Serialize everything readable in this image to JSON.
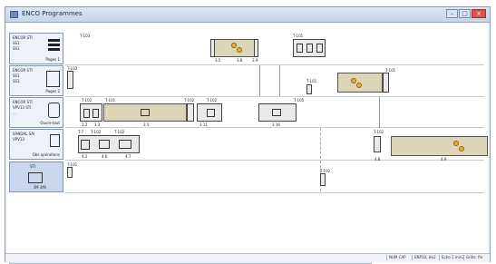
{
  "window": {
    "title": "ENCO Programmes"
  },
  "window_controls": {
    "minimize": "–",
    "maximize": "□",
    "close": "×"
  },
  "rows": [
    {
      "lines": [
        "ENCOR    STI",
        "SS1",
        "SS1"
      ],
      "caption": "Pages 1"
    },
    {
      "lines": [
        "ENCOR    STI",
        "SS1",
        "SS1"
      ],
      "caption": "Pages 2"
    },
    {
      "lines": [
        "ENCOR    STI",
        "VPV13   STI",
        "…"
      ],
      "caption": "Ouvre-tout"
    },
    {
      "lines": [
        "SANDAL    SAI",
        "VPV13"
      ],
      "caption": "Obs opérations"
    },
    {
      "lines": [
        "STI"
      ],
      "caption": "3M 4Mi"
    }
  ],
  "timeline_labels": [
    "T-103",
    "T-101",
    "T-103",
    "T-101",
    "T-101",
    "T-102",
    "T-101",
    "T-102",
    "T-102",
    "T-105",
    "T-7",
    "T-102",
    "T-102",
    "T-102",
    "T-101",
    "T-102",
    "T-102"
  ],
  "tick_labels": [
    "3.5",
    "3.8",
    "3.9",
    "3.2",
    "3.3",
    "3.5",
    "3.11",
    "3.16",
    "4.2",
    "4.6",
    "4.7",
    "4.8",
    "4.9"
  ],
  "status": {
    "p1": "NUM  CAP",
    "p2": "ENP10, Hn2",
    "p3": "Echo 1 min2",
    "p4": "Grille: fin"
  }
}
